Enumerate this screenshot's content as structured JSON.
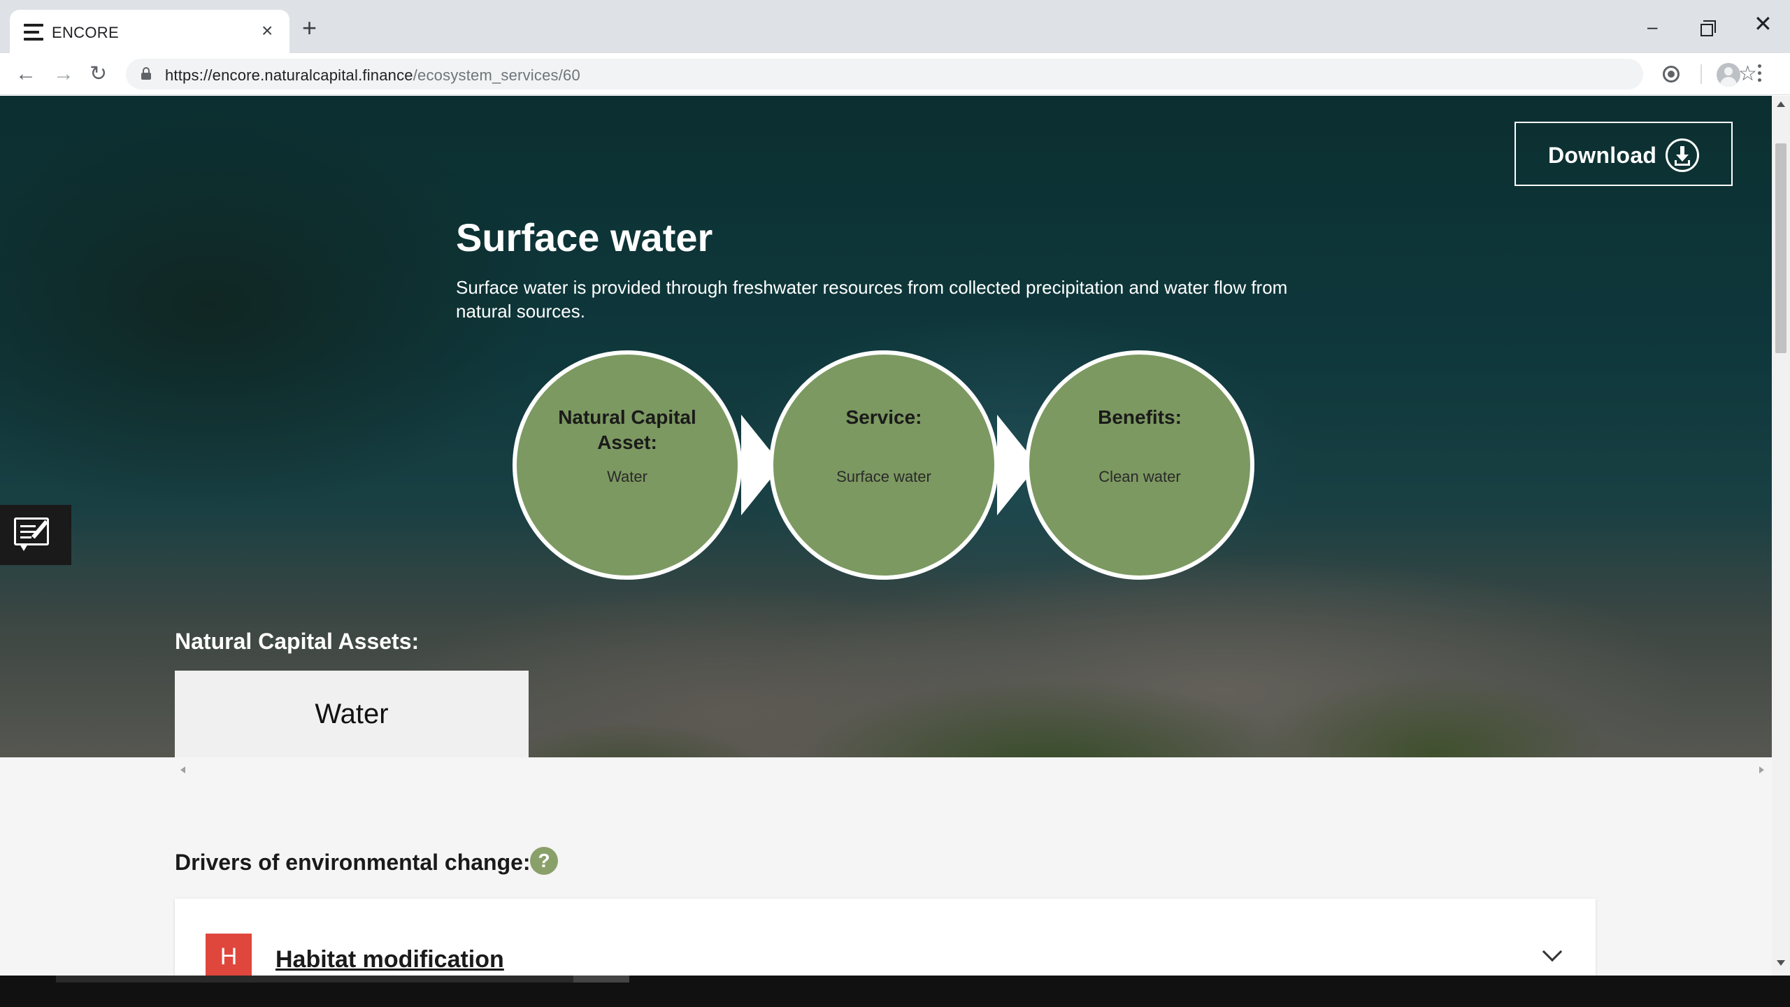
{
  "browser": {
    "tab_title": "ENCORE",
    "tab_close": "×",
    "new_tab": "+",
    "url_host": "https://encore.naturalcapital.finance",
    "url_path": "/ecosystem_services/60",
    "nav_back": "←",
    "nav_forward": "→",
    "nav_reload": "↻",
    "bookmark_star": "☆",
    "win_minimize": "–",
    "win_close": "✕"
  },
  "hero": {
    "download_label": "Download",
    "title": "Surface water",
    "description": "Surface water is provided through freshwater resources from collected precipitation and water flow from natural sources."
  },
  "flow": [
    {
      "heading": "Natural Capital Asset:",
      "value": "Water"
    },
    {
      "heading": "Service:",
      "value": "Surface water"
    },
    {
      "heading": "Benefits:",
      "value": "Clean water"
    }
  ],
  "assets": {
    "label": "Natural Capital Assets:",
    "items": [
      "Water"
    ]
  },
  "drivers": {
    "label": "Drivers of environmental change:",
    "help": "?",
    "items": [
      {
        "badge": "H",
        "title": "Habitat modification"
      }
    ]
  },
  "colors": {
    "circle_fill": "#7c9961",
    "driver_badge": "#e0473c",
    "help_icon": "#8aa06a"
  }
}
